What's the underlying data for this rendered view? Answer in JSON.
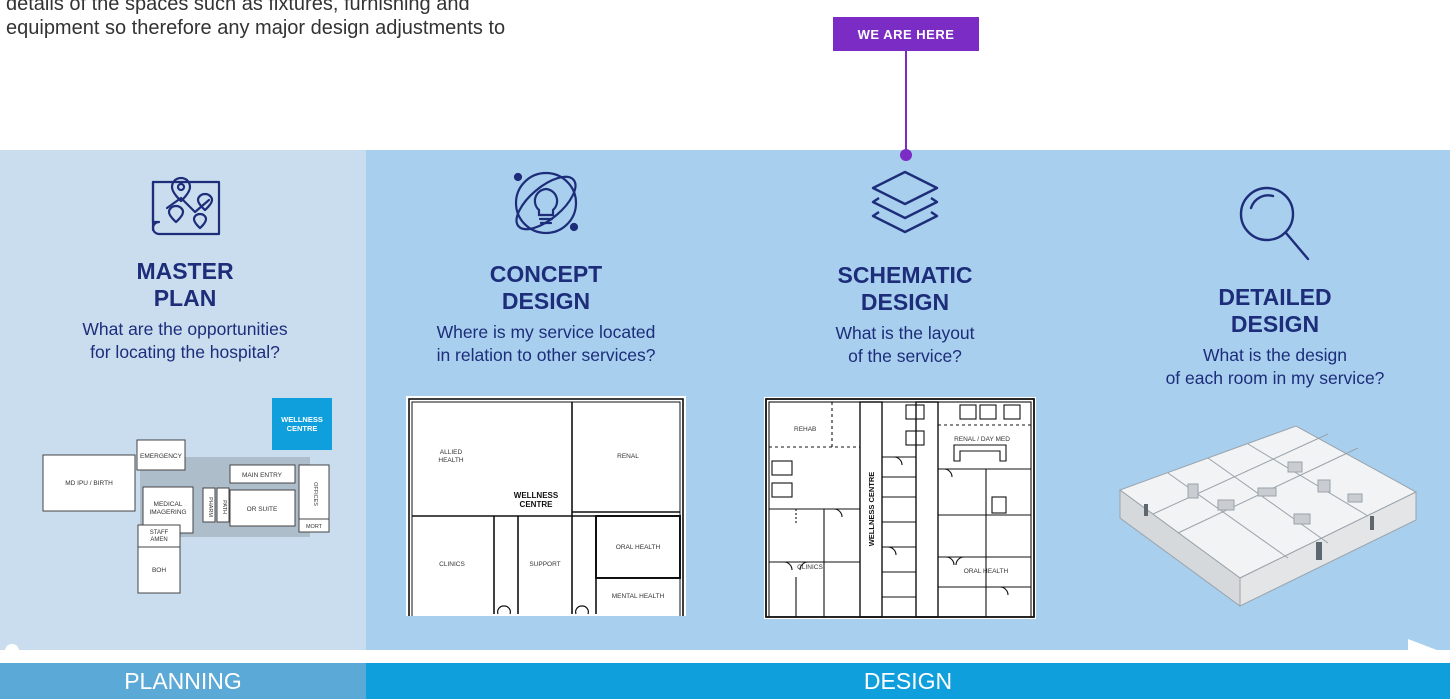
{
  "intro": {
    "line1": "details of the spaces such as fixtures, furnishing and",
    "line2": "equipment so therefore any major design adjustments to"
  },
  "marker": {
    "label": "WE ARE HERE",
    "color": "#7b2cc4"
  },
  "stages": [
    {
      "title1": "MASTER",
      "title2": "PLAN",
      "q1": "What are the opportunities",
      "q2": "for locating the hospital?",
      "icon": "map-pins-icon"
    },
    {
      "title1": "CONCEPT",
      "title2": "DESIGN",
      "q1": "Where is my service located",
      "q2": "in relation to other services?",
      "icon": "lightbulb-orbit-icon"
    },
    {
      "title1": "SCHEMATIC",
      "title2": "DESIGN",
      "q1": "What is the layout",
      "q2": "of the service?",
      "icon": "layers-icon"
    },
    {
      "title1": "DETAILED",
      "title2": "DESIGN",
      "q1": "What is the design",
      "q2": "of each room in my service?",
      "icon": "magnifier-icon"
    }
  ],
  "master_plan": {
    "wellness1": "WELLNESS",
    "wellness2": "CENTRE",
    "emergency": "EMERGENCY",
    "md_ipu": "MD IPU / BIRTH",
    "main_entry": "MAIN ENTRY",
    "medical1": "MEDICAL",
    "medical2": "IMAGERING",
    "pharm": "PHARM",
    "path": "PATH",
    "or_suite": "OR SUITE",
    "offices": "OFFICES",
    "mort": "MORT",
    "staff1": "STAFF",
    "staff2": "AMEN",
    "boh": "BOH"
  },
  "concept": {
    "allied1": "ALLIED",
    "allied2": "HEALTH",
    "renal": "RENAL",
    "wellness1": "WELLNESS",
    "wellness2": "CENTRE",
    "clinics": "CLINICS",
    "support": "SUPPORT",
    "oral": "ORAL HEALTH",
    "mental": "MENTAL HEALTH"
  },
  "schematic": {
    "rehab": "REHAB",
    "renal": "RENAL / DAY MED",
    "wellness": "WELLNESS CENTRE",
    "clinics": "CLINICS",
    "oral": "ORAL HEALTH"
  },
  "bands": {
    "planning": "PLANNING",
    "design": "DESIGN"
  },
  "colors": {
    "planning_panel": "#c9ddef",
    "design_panel": "#a8cfee",
    "planning_band": "#5aa9d6",
    "design_band": "#0f9fdc",
    "title": "#1d2d7a"
  }
}
